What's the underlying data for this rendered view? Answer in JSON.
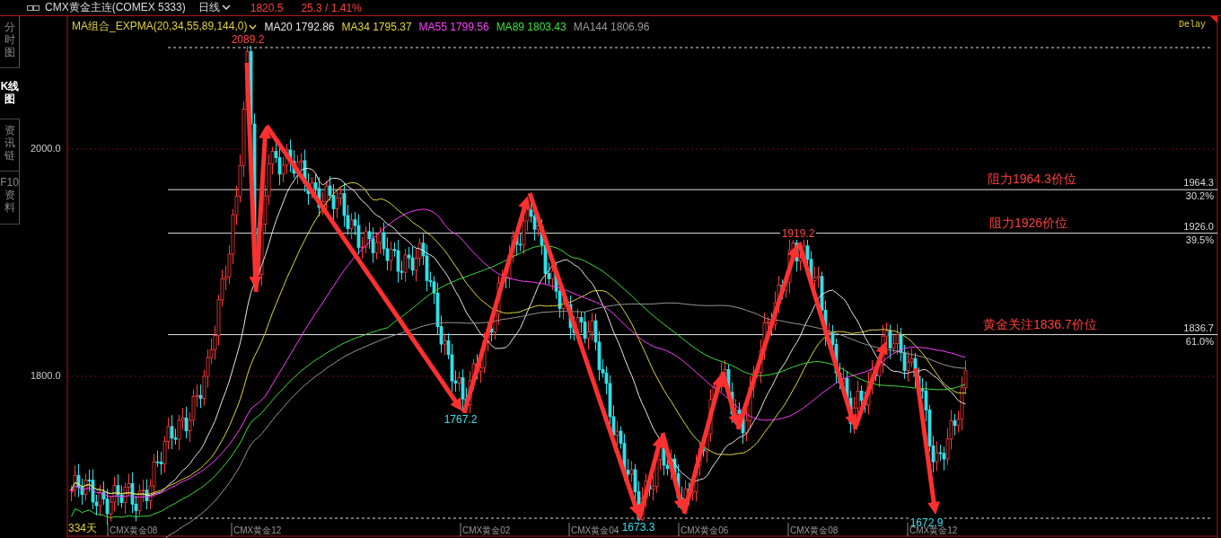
{
  "header": {
    "symbol": "CMX黄金主连(COMEX 5333)",
    "period": "日线",
    "price": "1820.5",
    "change": "25.3 / 1.41%"
  },
  "side_tabs": [
    {
      "label": "分时图",
      "selected": false
    },
    {
      "label": "K线图",
      "selected": true
    },
    {
      "label": "资讯链",
      "selected": false
    },
    {
      "label": "F10资料",
      "selected": false
    }
  ],
  "indicator": {
    "name": "MA组合_EXPMA(20,34,55,89,144,0)",
    "lines": [
      {
        "label": "MA20 1792.86",
        "color": "#e8e8e8"
      },
      {
        "label": "MA34 1795.37",
        "color": "#e0d840"
      },
      {
        "label": "MA55 1799.56",
        "color": "#ff40ff"
      },
      {
        "label": "MA89 1803.43",
        "color": "#40e040"
      },
      {
        "label": "MA144 1806.96",
        "color": "#9a9a9a"
      }
    ]
  },
  "status": "Delay",
  "y_ticks": [
    "2000.0",
    "1800.0"
  ],
  "price_levels": [
    {
      "note": "阻力1964.3价位",
      "price": "1964.3",
      "ratio": "30.2%"
    },
    {
      "note": "阻力1926价位",
      "price": "1926.0",
      "ratio": "39.5%"
    },
    {
      "note": "黄金关注1836.7价位",
      "price": "1836.7",
      "ratio": "61.0%"
    }
  ],
  "point_labels": [
    {
      "text": "2089.2",
      "kind": "high"
    },
    {
      "text": "1767.2",
      "kind": "low"
    },
    {
      "text": "1673.3",
      "kind": "low"
    },
    {
      "text": "1919.2",
      "kind": "high"
    },
    {
      "text": "1672.9",
      "kind": "low"
    }
  ],
  "x_labels": [
    "CMX黄金08",
    "CMX黄金12",
    "CMX黄金02",
    "CMX黄金04",
    "CMX黄金06",
    "CMX黄金08",
    "CMX黄金12"
  ],
  "bar_count": "334天"
}
